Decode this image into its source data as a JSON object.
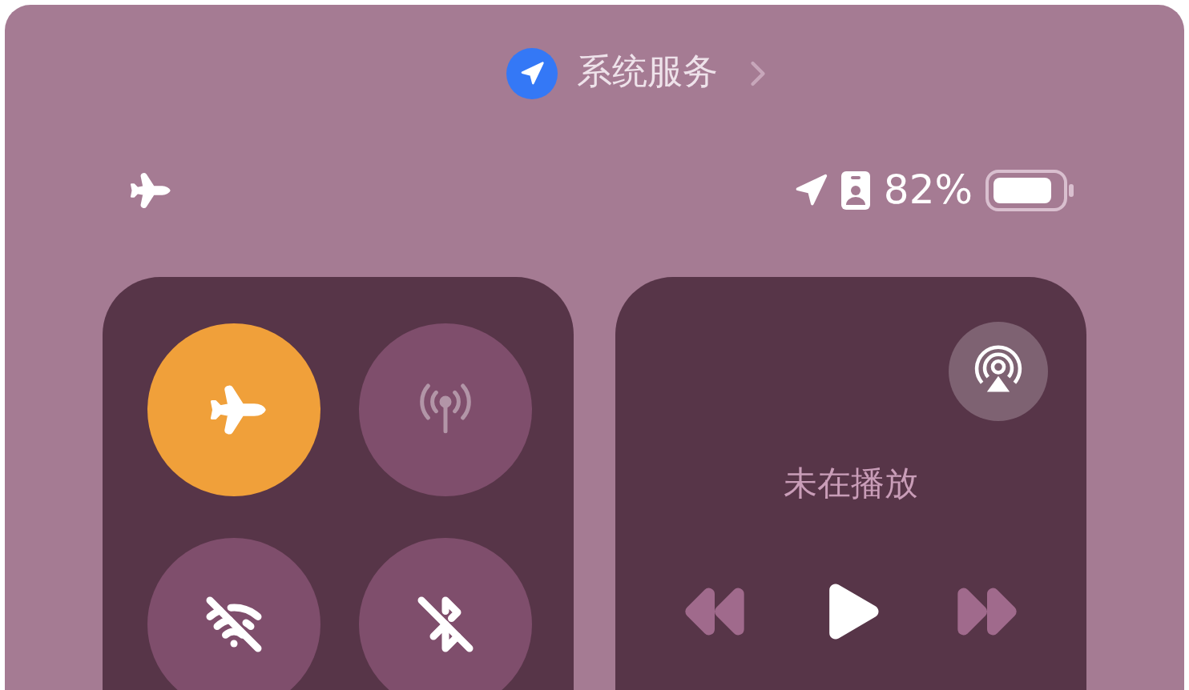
{
  "location_banner": {
    "label": "系统服务"
  },
  "status_bar": {
    "battery_percent": "82%"
  },
  "connectivity": {
    "toggles": [
      {
        "kind": "airplane",
        "on": true,
        "disabled": false
      },
      {
        "kind": "cellular",
        "on": false,
        "disabled": true
      },
      {
        "kind": "wifi",
        "on": false,
        "disabled": false
      },
      {
        "kind": "bluetooth",
        "on": false,
        "disabled": false
      }
    ]
  },
  "now_playing": {
    "status": "未在播放",
    "previous_disabled": true,
    "next_disabled": true
  }
}
